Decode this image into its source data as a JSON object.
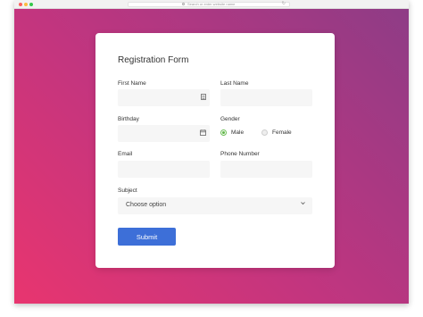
{
  "browser": {
    "url_placeholder": "Search or enter website name"
  },
  "form": {
    "title": "Registration Form",
    "first_name": {
      "label": "First Name",
      "value": ""
    },
    "last_name": {
      "label": "Last Name",
      "value": ""
    },
    "birthday": {
      "label": "Birthday",
      "value": ""
    },
    "gender": {
      "label": "Gender",
      "options": [
        "Male",
        "Female"
      ],
      "selected": "Male"
    },
    "email": {
      "label": "Email",
      "value": ""
    },
    "phone": {
      "label": "Phone Number",
      "value": ""
    },
    "subject": {
      "label": "Subject",
      "selected": "Choose option"
    },
    "submit_label": "Submit"
  },
  "colors": {
    "gradient_start": "#e8356f",
    "gradient_end": "#8e3c86",
    "button": "#3d6fd8",
    "radio_checked": "#5fb546"
  },
  "icons": {
    "first_name_field": "contact-card-icon",
    "birthday_field": "calendar-icon",
    "subject_field": "chevron-down-icon"
  }
}
